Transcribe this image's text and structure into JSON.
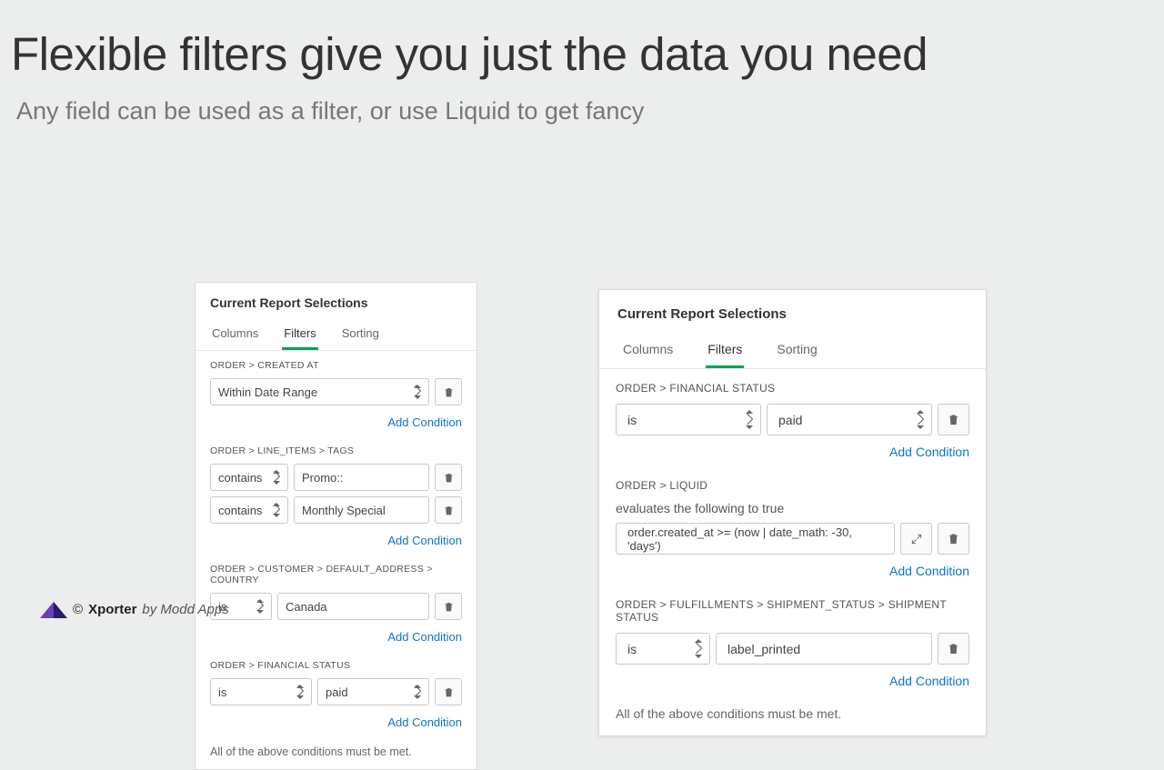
{
  "title": "Flexible filters give you just the data you need",
  "subtitle": "Any field can be used as a filter, or use Liquid to get fancy",
  "tabs": [
    "Columns",
    "Filters",
    "Sorting"
  ],
  "active_tab": "Filters",
  "panel_title": "Current Report Selections",
  "add_condition_label": "Add Condition",
  "footer_note": "All of the above conditions must be met.",
  "left": {
    "groups": [
      {
        "label": "ORDER > CREATED AT",
        "rows": [
          {
            "op": "Within Date Range",
            "single": true
          }
        ]
      },
      {
        "label": "ORDER > LINE_ITEMS > TAGS",
        "rows": [
          {
            "op": "contains",
            "val": "Promo::"
          },
          {
            "op": "contains",
            "val": "Monthly Special"
          }
        ]
      },
      {
        "label": "ORDER > CUSTOMER > DEFAULT_ADDRESS > COUNTRY",
        "rows": [
          {
            "op": "is",
            "val": "Canada"
          }
        ]
      },
      {
        "label": "ORDER > FINANCIAL STATUS",
        "rows": [
          {
            "op": "is",
            "val": "paid",
            "valSelect": true
          }
        ]
      }
    ]
  },
  "right": {
    "groups": [
      {
        "label": "ORDER > FINANCIAL STATUS",
        "rows": [
          {
            "op": "is",
            "val": "paid",
            "valSelect": true
          }
        ]
      },
      {
        "label": "ORDER > LIQUID",
        "sublabel": "evaluates the following to true",
        "rows": [
          {
            "liquid": "order.created_at >= (now | date_math: -30, 'days')"
          }
        ]
      },
      {
        "label": "ORDER > FULFILLMENTS > SHIPMENT_STATUS > SHIPMENT STATUS",
        "rows": [
          {
            "op": "is",
            "val": "label_printed"
          }
        ]
      }
    ]
  },
  "brand": {
    "copyright": "©",
    "name": "Xporter",
    "by": "by Modd Apps"
  }
}
